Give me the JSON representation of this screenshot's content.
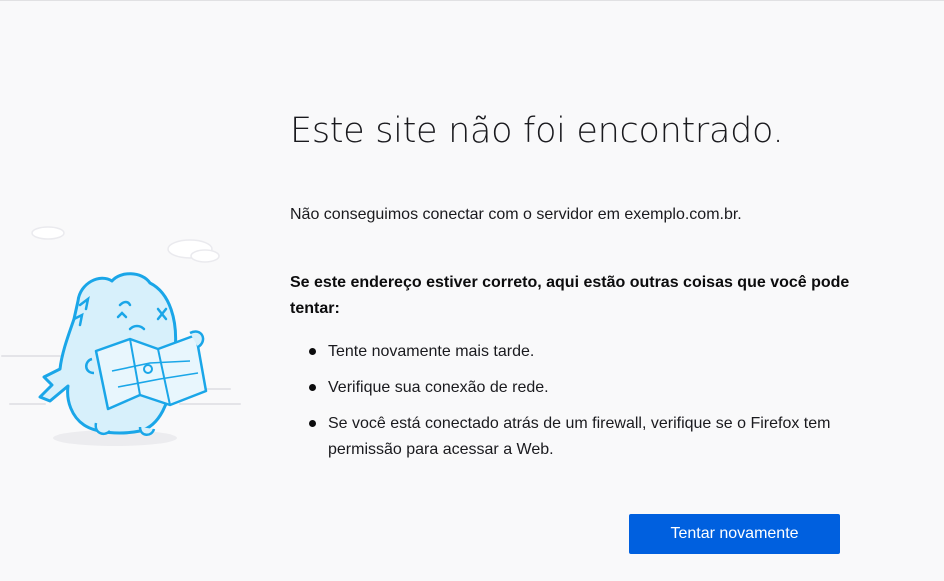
{
  "error": {
    "title": "Este site não foi encontrado.",
    "description": "Não conseguimos conectar com o servidor em exemplo.com.br.",
    "suggestions_heading": "Se este endereço estiver correto, aqui estão outras coisas que você pode tentar:",
    "suggestions": [
      "Tente novamente mais tarde.",
      "Verifique sua conexão de rede.",
      "Se você está conectado atrás de um firewall, verifique se o Firefox tem permissão para acessar a Web."
    ]
  },
  "actions": {
    "retry_label": "Tentar novamente"
  },
  "illustration": {
    "icon": "lost-monster-with-map-icon"
  },
  "colors": {
    "background": "#f9f9fa",
    "primary_button": "#0060df",
    "illustration_outline": "#1aa6e8",
    "illustration_fill": "#d7f0fb"
  }
}
